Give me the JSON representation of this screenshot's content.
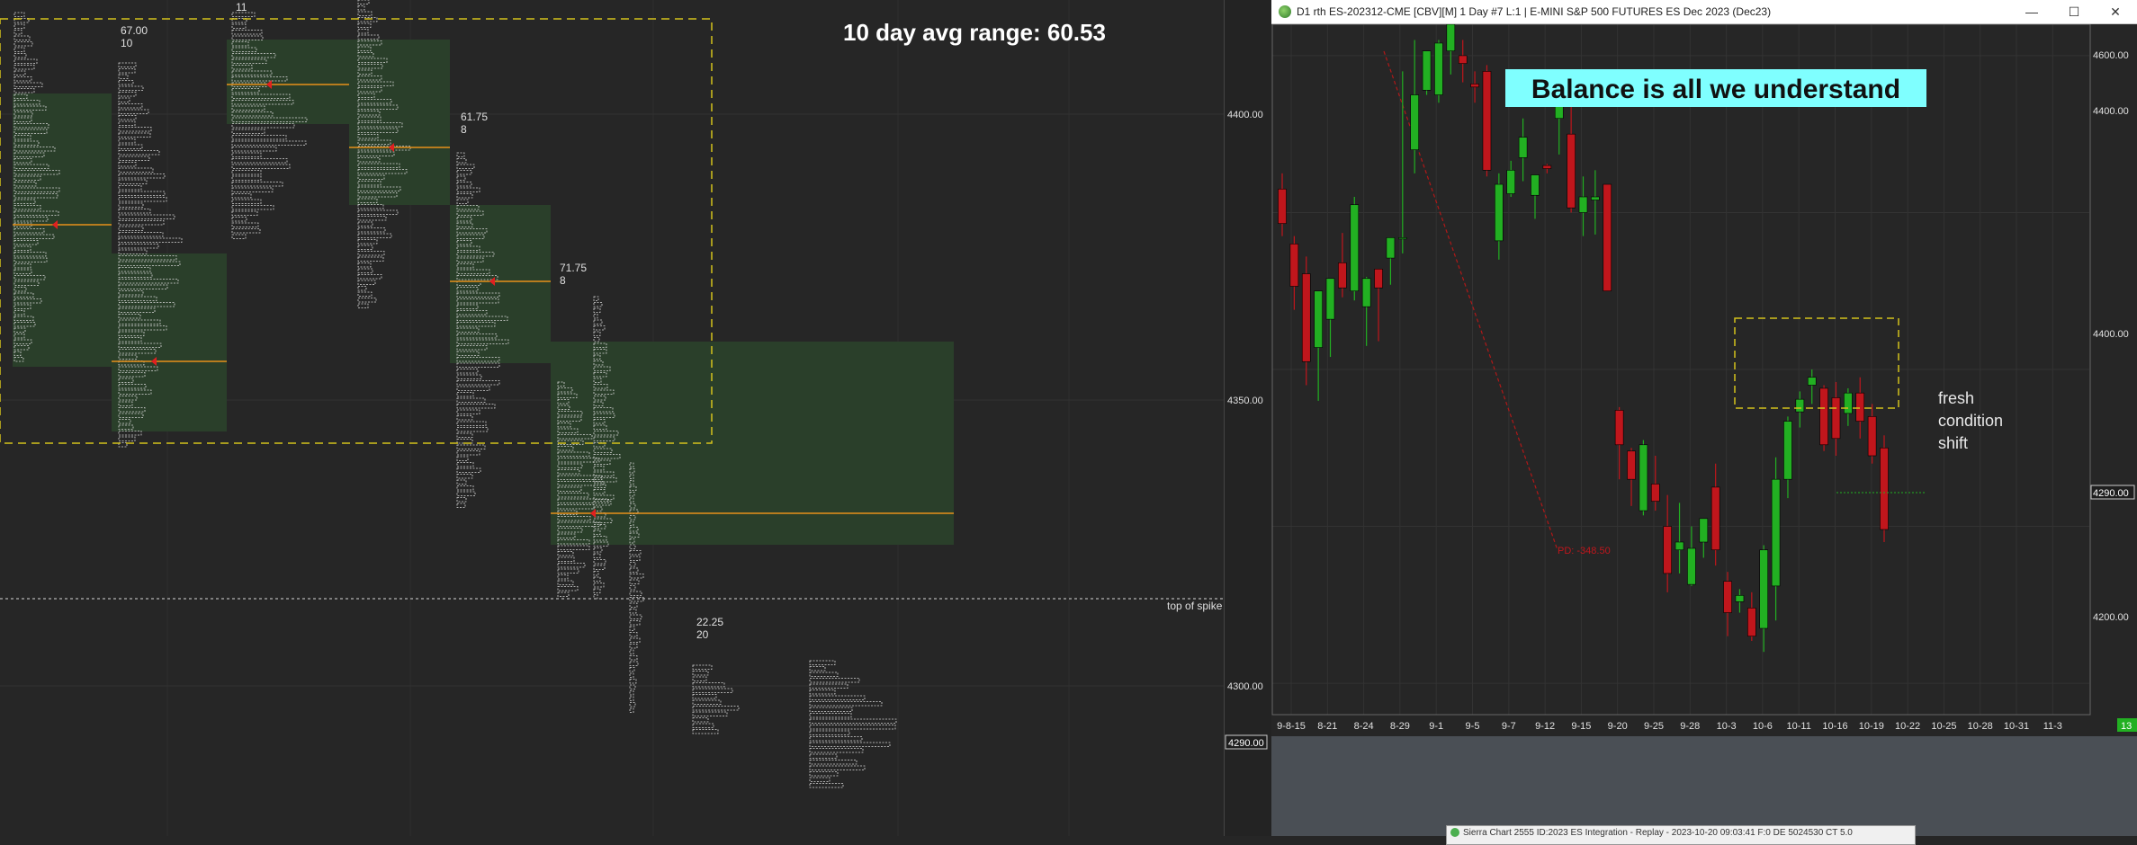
{
  "left_panel": {
    "avg_range_label": "10 day avg range:  60.53",
    "top_of_spike_label": "top of spike",
    "price_axis": [
      "4400.00",
      "4350.00",
      "4300.00",
      "4290.00"
    ],
    "last_price": "4290.00",
    "annotations": [
      {
        "line1": "67.00",
        "line2": "10"
      },
      {
        "line1": "11",
        "line2": ""
      },
      {
        "line1": "61.75",
        "line2": "8"
      },
      {
        "line1": "71.75",
        "line2": "8"
      },
      {
        "line1": "22.25",
        "line2": "20"
      }
    ],
    "colors": {
      "value_area": "#2a3f2a",
      "poc": "#e8901a",
      "dashed_box": "#d4c21c",
      "letters": "#d8d8d8"
    }
  },
  "right_window": {
    "title": "D1 rth ES-202312-CME [CBV][M]  1 Day  #7 L:1 | E-MINI S&P 500 FUTURES ES Dec 2023 (Dec23)",
    "window_buttons": [
      "—",
      "☐",
      "✕"
    ],
    "banner": "Balance is all we understand",
    "pd_label": "PD: -348.50",
    "note": [
      "fresh",
      "condition",
      "shift"
    ],
    "price_axis": [
      "4600.00",
      "4400.00",
      "4400.00",
      "4290.00",
      "4200.00"
    ],
    "last_price": "4290.00",
    "corner_badge": "13",
    "colors": {
      "up": "#22b022",
      "down": "#c0161c",
      "banner_bg": "#7fffff",
      "box": "#d4c21c"
    }
  },
  "bottom_window": {
    "title": "Sierra Chart 2555 ID:2023 ES Integration - Replay - 2023-10-20 09:03:41 F:0 DE 5024530 CT 5.0"
  },
  "chart_data": [
    {
      "type": "candlestick",
      "title": "D1 rth ES-202312-CME [CBV][M]  1 Day  #7 L:1 | E-MINI S&P 500 FUTURES ES Dec 2023 (Dec23)",
      "x_tick_labels": [
        "9-8-15",
        "8-21",
        "8-24",
        "8-29",
        "9-1",
        "9-5",
        "9-7",
        "9-12",
        "9-15",
        "9-20",
        "9-25",
        "9-28",
        "10-3",
        "10-6",
        "10-11",
        "10-16",
        "10-19",
        "10-22",
        "10-25",
        "10-28",
        "10-31",
        "11-3"
      ],
      "candles": [
        {
          "o": 4515,
          "h": 4525,
          "l": 4485,
          "c": 4493
        },
        {
          "o": 4480,
          "h": 4485,
          "l": 4438,
          "c": 4453
        },
        {
          "o": 4461,
          "h": 4472,
          "l": 4390,
          "c": 4405
        },
        {
          "o": 4414,
          "h": 4433,
          "l": 4380,
          "c": 4450
        },
        {
          "o": 4432,
          "h": 4447,
          "l": 4408,
          "c": 4458
        },
        {
          "o": 4468,
          "h": 4487,
          "l": 4446,
          "c": 4452
        },
        {
          "o": 4450,
          "h": 4510,
          "l": 4444,
          "c": 4505
        },
        {
          "o": 4440,
          "h": 4459,
          "l": 4415,
          "c": 4458
        },
        {
          "o": 4464,
          "h": 4464,
          "l": 4418,
          "c": 4452
        },
        {
          "o": 4471,
          "h": 4483,
          "l": 4454,
          "c": 4484
        },
        {
          "o": 4484,
          "h": 4590,
          "l": 4474,
          "c": 4484
        },
        {
          "o": 4540,
          "h": 4610,
          "l": 4525,
          "c": 4575
        },
        {
          "o": 4578,
          "h": 4603,
          "l": 4575,
          "c": 4603
        },
        {
          "o": 4575,
          "h": 4610,
          "l": 4570,
          "c": 4608
        },
        {
          "o": 4603,
          "h": 4623,
          "l": 4588,
          "c": 4620
        },
        {
          "o": 4600,
          "h": 4610,
          "l": 4583,
          "c": 4595
        },
        {
          "o": 4582,
          "h": 4590,
          "l": 4570,
          "c": 4580
        },
        {
          "o": 4590,
          "h": 4594,
          "l": 4523,
          "c": 4527
        },
        {
          "o": 4482,
          "h": 4525,
          "l": 4470,
          "c": 4518
        },
        {
          "o": 4512,
          "h": 4533,
          "l": 4510,
          "c": 4527
        },
        {
          "o": 4535,
          "h": 4560,
          "l": 4520,
          "c": 4548
        },
        {
          "o": 4511,
          "h": 4520,
          "l": 4496,
          "c": 4524
        },
        {
          "o": 4530,
          "h": 4531,
          "l": 4525,
          "c": 4528
        },
        {
          "o": 4560,
          "h": 4572,
          "l": 4537,
          "c": 4570
        },
        {
          "o": 4550,
          "h": 4570,
          "l": 4500,
          "c": 4503
        },
        {
          "o": 4500,
          "h": 4523,
          "l": 4485,
          "c": 4510
        },
        {
          "o": 4508,
          "h": 4527,
          "l": 4486,
          "c": 4510
        },
        {
          "o": 4518,
          "h": 4510,
          "l": 4450,
          "c": 4450
        },
        {
          "o": 4374,
          "h": 4376,
          "l": 4330,
          "c": 4352
        },
        {
          "o": 4348,
          "h": 4350,
          "l": 4313,
          "c": 4330
        },
        {
          "o": 4310,
          "h": 4355,
          "l": 4307,
          "c": 4352
        },
        {
          "o": 4327,
          "h": 4345,
          "l": 4310,
          "c": 4316
        },
        {
          "o": 4300,
          "h": 4320,
          "l": 4258,
          "c": 4270
        },
        {
          "o": 4285,
          "h": 4315,
          "l": 4270,
          "c": 4290
        },
        {
          "o": 4263,
          "h": 4300,
          "l": 4262,
          "c": 4286
        },
        {
          "o": 4290,
          "h": 4291,
          "l": 4280,
          "c": 4305
        },
        {
          "o": 4325,
          "h": 4340,
          "l": 4275,
          "c": 4285
        },
        {
          "o": 4265,
          "h": 4271,
          "l": 4230,
          "c": 4245
        },
        {
          "o": 4252,
          "h": 4260,
          "l": 4245,
          "c": 4256
        },
        {
          "o": 4248,
          "h": 4258,
          "l": 4227,
          "c": 4230
        },
        {
          "o": 4235,
          "h": 4288,
          "l": 4220,
          "c": 4285
        },
        {
          "o": 4262,
          "h": 4344,
          "l": 4240,
          "c": 4330
        },
        {
          "o": 4330,
          "h": 4370,
          "l": 4318,
          "c": 4367
        },
        {
          "o": 4373,
          "h": 4386,
          "l": 4363,
          "c": 4381
        },
        {
          "o": 4390,
          "h": 4400,
          "l": 4378,
          "c": 4395
        },
        {
          "o": 4388,
          "h": 4390,
          "l": 4348,
          "c": 4352
        },
        {
          "o": 4382,
          "h": 4392,
          "l": 4345,
          "c": 4356
        },
        {
          "o": 4372,
          "h": 4388,
          "l": 4364,
          "c": 4385
        },
        {
          "o": 4385,
          "h": 4395,
          "l": 4356,
          "c": 4367
        },
        {
          "o": 4370,
          "h": 4378,
          "l": 4340,
          "c": 4345
        },
        {
          "o": 4350,
          "h": 4358,
          "l": 4290,
          "c": 4298
        }
      ],
      "y_tick_labels": [
        "4600.00",
        "4400.00",
        "4200.00"
      ],
      "last_price": 4290.0,
      "annotations": [
        "Balance is all we understand",
        "PD: -348.50",
        "fresh condition shift"
      ]
    }
  ]
}
